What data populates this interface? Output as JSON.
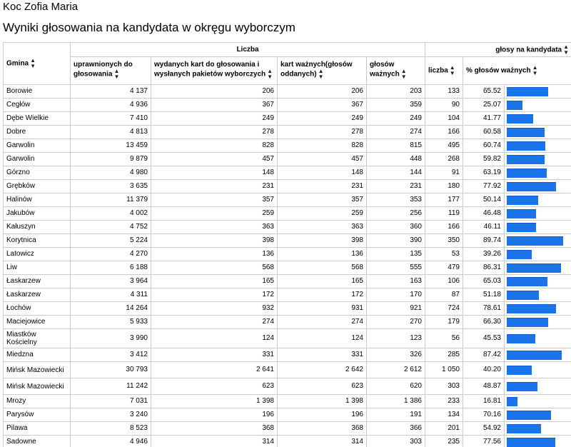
{
  "header": {
    "candidate": "Koc Zofia Maria",
    "title": "Wyniki głosowania na kandydata w okręgu wyborczym"
  },
  "table": {
    "group_liczba": "Liczba",
    "group_glosy": "głosy na kandydata",
    "col_gmina": "Gmina",
    "col_uprawnionych": "uprawnionych do głosowania",
    "col_wydanych": "wydanych kart do głosowania i wysłanych pakietów wyborczych",
    "col_kart": "kart ważnych(głosów oddanych)",
    "col_glosow": "głosów ważnych",
    "col_liczba": "liczba",
    "col_procent": "% głosów ważnych",
    "sort_icon": "sort-up-down-icon",
    "bar_color": "#1a73e8",
    "rows": [
      {
        "gmina": "Borowie",
        "uprawnionych": "4 137",
        "wydanych": "206",
        "kart": "206",
        "glosow": "203",
        "liczba": "133",
        "procent": "65.52",
        "pct": 65.52
      },
      {
        "gmina": "Cegłów",
        "uprawnionych": "4 936",
        "wydanych": "367",
        "kart": "367",
        "glosow": "359",
        "liczba": "90",
        "procent": "25.07",
        "pct": 25.07
      },
      {
        "gmina": "Dębe Wielkie",
        "uprawnionych": "7 410",
        "wydanych": "249",
        "kart": "249",
        "glosow": "249",
        "liczba": "104",
        "procent": "41.77",
        "pct": 41.77
      },
      {
        "gmina": "Dobre",
        "uprawnionych": "4 813",
        "wydanych": "278",
        "kart": "278",
        "glosow": "274",
        "liczba": "166",
        "procent": "60.58",
        "pct": 60.58
      },
      {
        "gmina": "Garwolin",
        "uprawnionych": "13 459",
        "wydanych": "828",
        "kart": "828",
        "glosow": "815",
        "liczba": "495",
        "procent": "60.74",
        "pct": 60.74
      },
      {
        "gmina": "Garwolin",
        "uprawnionych": "9 879",
        "wydanych": "457",
        "kart": "457",
        "glosow": "448",
        "liczba": "268",
        "procent": "59.82",
        "pct": 59.82
      },
      {
        "gmina": "Górzno",
        "uprawnionych": "4 980",
        "wydanych": "148",
        "kart": "148",
        "glosow": "144",
        "liczba": "91",
        "procent": "63.19",
        "pct": 63.19
      },
      {
        "gmina": "Grębków",
        "uprawnionych": "3 635",
        "wydanych": "231",
        "kart": "231",
        "glosow": "231",
        "liczba": "180",
        "procent": "77.92",
        "pct": 77.92
      },
      {
        "gmina": "Halinów",
        "uprawnionych": "11 379",
        "wydanych": "357",
        "kart": "357",
        "glosow": "353",
        "liczba": "177",
        "procent": "50.14",
        "pct": 50.14
      },
      {
        "gmina": "Jakubów",
        "uprawnionych": "4 002",
        "wydanych": "259",
        "kart": "259",
        "glosow": "256",
        "liczba": "119",
        "procent": "46.48",
        "pct": 46.48
      },
      {
        "gmina": "Kałuszyn",
        "uprawnionych": "4 752",
        "wydanych": "363",
        "kart": "363",
        "glosow": "360",
        "liczba": "166",
        "procent": "46.11",
        "pct": 46.11
      },
      {
        "gmina": "Korytnica",
        "uprawnionych": "5 224",
        "wydanych": "398",
        "kart": "398",
        "glosow": "390",
        "liczba": "350",
        "procent": "89.74",
        "pct": 89.74
      },
      {
        "gmina": "Latowicz",
        "uprawnionych": "4 270",
        "wydanych": "136",
        "kart": "136",
        "glosow": "135",
        "liczba": "53",
        "procent": "39.26",
        "pct": 39.26
      },
      {
        "gmina": "Liw",
        "uprawnionych": "6 188",
        "wydanych": "568",
        "kart": "568",
        "glosow": "555",
        "liczba": "479",
        "procent": "86.31",
        "pct": 86.31
      },
      {
        "gmina": "Łaskarzew",
        "uprawnionych": "3 964",
        "wydanych": "165",
        "kart": "165",
        "glosow": "163",
        "liczba": "106",
        "procent": "65.03",
        "pct": 65.03
      },
      {
        "gmina": "Łaskarzew",
        "uprawnionych": "4 311",
        "wydanych": "172",
        "kart": "172",
        "glosow": "170",
        "liczba": "87",
        "procent": "51.18",
        "pct": 51.18
      },
      {
        "gmina": "Łochów",
        "uprawnionych": "14 264",
        "wydanych": "932",
        "kart": "931",
        "glosow": "921",
        "liczba": "724",
        "procent": "78.61",
        "pct": 78.61
      },
      {
        "gmina": "Maciejowice",
        "uprawnionych": "5 933",
        "wydanych": "274",
        "kart": "274",
        "glosow": "270",
        "liczba": "179",
        "procent": "66.30",
        "pct": 66.3
      },
      {
        "gmina": "Miastków Kościelny",
        "uprawnionych": "3 990",
        "wydanych": "124",
        "kart": "124",
        "glosow": "123",
        "liczba": "56",
        "procent": "45.53",
        "pct": 45.53
      },
      {
        "gmina": "Miedzna",
        "uprawnionych": "3 412",
        "wydanych": "331",
        "kart": "331",
        "glosow": "326",
        "liczba": "285",
        "procent": "87.42",
        "pct": 87.42
      },
      {
        "gmina": "Mińsk Mazowiecki",
        "uprawnionych": "30 793",
        "wydanych": "2 641",
        "kart": "2 642",
        "glosow": "2 612",
        "liczba": "1 050",
        "procent": "40.20",
        "pct": 40.2
      },
      {
        "gmina": "Mińsk Mazowiecki",
        "uprawnionych": "11 242",
        "wydanych": "623",
        "kart": "623",
        "glosow": "620",
        "liczba": "303",
        "procent": "48.87",
        "pct": 48.87
      },
      {
        "gmina": "Mrozy",
        "uprawnionych": "7 031",
        "wydanych": "1 398",
        "kart": "1 398",
        "glosow": "1 386",
        "liczba": "233",
        "procent": "16.81",
        "pct": 16.81
      },
      {
        "gmina": "Parysów",
        "uprawnionych": "3 240",
        "wydanych": "196",
        "kart": "196",
        "glosow": "191",
        "liczba": "134",
        "procent": "70.16",
        "pct": 70.16
      },
      {
        "gmina": "Pilawa",
        "uprawnionych": "8 523",
        "wydanych": "368",
        "kart": "368",
        "glosow": "366",
        "liczba": "201",
        "procent": "54.92",
        "pct": 54.92
      },
      {
        "gmina": "Sadowne",
        "uprawnionych": "4 946",
        "wydanych": "314",
        "kart": "314",
        "glosow": "303",
        "liczba": "235",
        "procent": "77.56",
        "pct": 77.56
      }
    ]
  }
}
